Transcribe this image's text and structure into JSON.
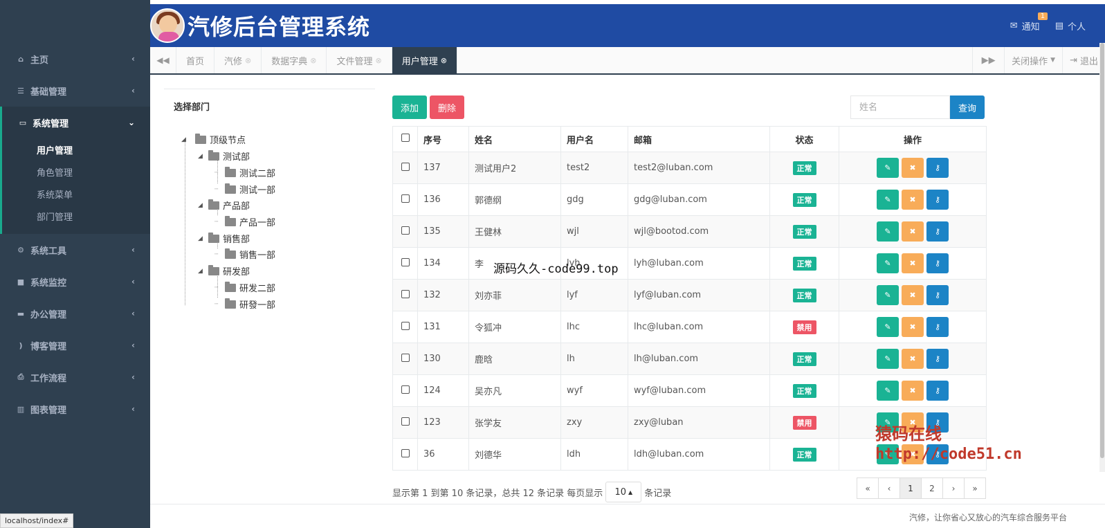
{
  "app": {
    "title": "汽修后台管理系统"
  },
  "header": {
    "notify_label": "通知",
    "notify_count": "1",
    "personal_label": "个人"
  },
  "sidebar": {
    "items": [
      {
        "icon": "home-icon",
        "label": "主页"
      },
      {
        "icon": "list-icon",
        "label": "基础管理"
      },
      {
        "icon": "monitor-icon",
        "label": "系统管理",
        "expanded": true,
        "children": [
          "用户管理",
          "角色管理",
          "系统菜单",
          "部门管理"
        ]
      },
      {
        "icon": "gear-icon",
        "label": "系统工具"
      },
      {
        "icon": "video-icon",
        "label": "系统监控"
      },
      {
        "icon": "laptop-icon",
        "label": "办公管理"
      },
      {
        "icon": "rss-icon",
        "label": "博客管理"
      },
      {
        "icon": "print-icon",
        "label": "工作流程"
      },
      {
        "icon": "chart-icon",
        "label": "图表管理"
      }
    ]
  },
  "tabs": [
    {
      "label": "首页",
      "closable": false
    },
    {
      "label": "汽修",
      "closable": true
    },
    {
      "label": "数据字典",
      "closable": true
    },
    {
      "label": "文件管理",
      "closable": true
    },
    {
      "label": "用户管理",
      "closable": true,
      "active": true
    }
  ],
  "tabbar": {
    "close_ops": "关闭操作",
    "logout": "退出"
  },
  "dept_tree": {
    "title": "选择部门",
    "root": "顶级节点",
    "nodes": [
      {
        "label": "测试部",
        "children": [
          "测试二部",
          "测试一部"
        ]
      },
      {
        "label": "产品部",
        "children": [
          "产品一部"
        ]
      },
      {
        "label": "销售部",
        "children": [
          "销售一部"
        ]
      },
      {
        "label": "研发部",
        "children": [
          "研发二部",
          "研發一部"
        ]
      }
    ]
  },
  "toolbar": {
    "add": "添加",
    "delete": "删除"
  },
  "search": {
    "placeholder": "姓名",
    "button": "查询"
  },
  "table": {
    "columns": [
      "序号",
      "姓名",
      "用户名",
      "邮箱",
      "状态",
      "操作"
    ],
    "rows": [
      {
        "id": "137",
        "name": "测试用户2",
        "username": "test2",
        "email": "test2@luban.com",
        "status": "正常"
      },
      {
        "id": "136",
        "name": "郭德纲",
        "username": "gdg",
        "email": "gdg@luban.com",
        "status": "正常"
      },
      {
        "id": "135",
        "name": "王健林",
        "username": "wjl",
        "email": "wjl@bootod.com",
        "status": "正常"
      },
      {
        "id": "134",
        "name": "李",
        "username": "lyh",
        "email": "lyh@luban.com",
        "status": "正常"
      },
      {
        "id": "132",
        "name": "刘亦菲",
        "username": "lyf",
        "email": "lyf@luban.com",
        "status": "正常"
      },
      {
        "id": "131",
        "name": "令狐冲",
        "username": "lhc",
        "email": "lhc@luban.com",
        "status": "禁用"
      },
      {
        "id": "130",
        "name": "鹿晗",
        "username": "lh",
        "email": "lh@luban.com",
        "status": "正常"
      },
      {
        "id": "124",
        "name": "吴亦凡",
        "username": "wyf",
        "email": "wyf@luban.com",
        "status": "正常"
      },
      {
        "id": "123",
        "name": "张学友",
        "username": "zxy",
        "email": "zxy@luban",
        "status": "禁用"
      },
      {
        "id": "36",
        "name": "刘德华",
        "username": "ldh",
        "email": "ldh@luban.com",
        "status": "正常"
      }
    ]
  },
  "pager": {
    "info_prefix": "显示第 1 到第 10 条记录，总共 12 条记录 每页显示",
    "page_size": "10",
    "info_suffix": "条记录",
    "buttons": [
      "«",
      "‹",
      "1",
      "2",
      "›",
      "»"
    ],
    "current": "1"
  },
  "footer": {
    "text": "汽修，让你省心又放心的汽车综合服务平台"
  },
  "statusbar": {
    "url": "localhost/index#"
  },
  "watermarks": {
    "a": "源码久久-code99.top",
    "b1": "猿码在线",
    "b2": "http://code51.cn"
  },
  "colors": {
    "sidebar": "#2f4050",
    "header": "#1f4ba3",
    "primary": "#1ab394",
    "danger": "#ed5565",
    "warning": "#f8ac59",
    "info": "#1c84c6"
  }
}
